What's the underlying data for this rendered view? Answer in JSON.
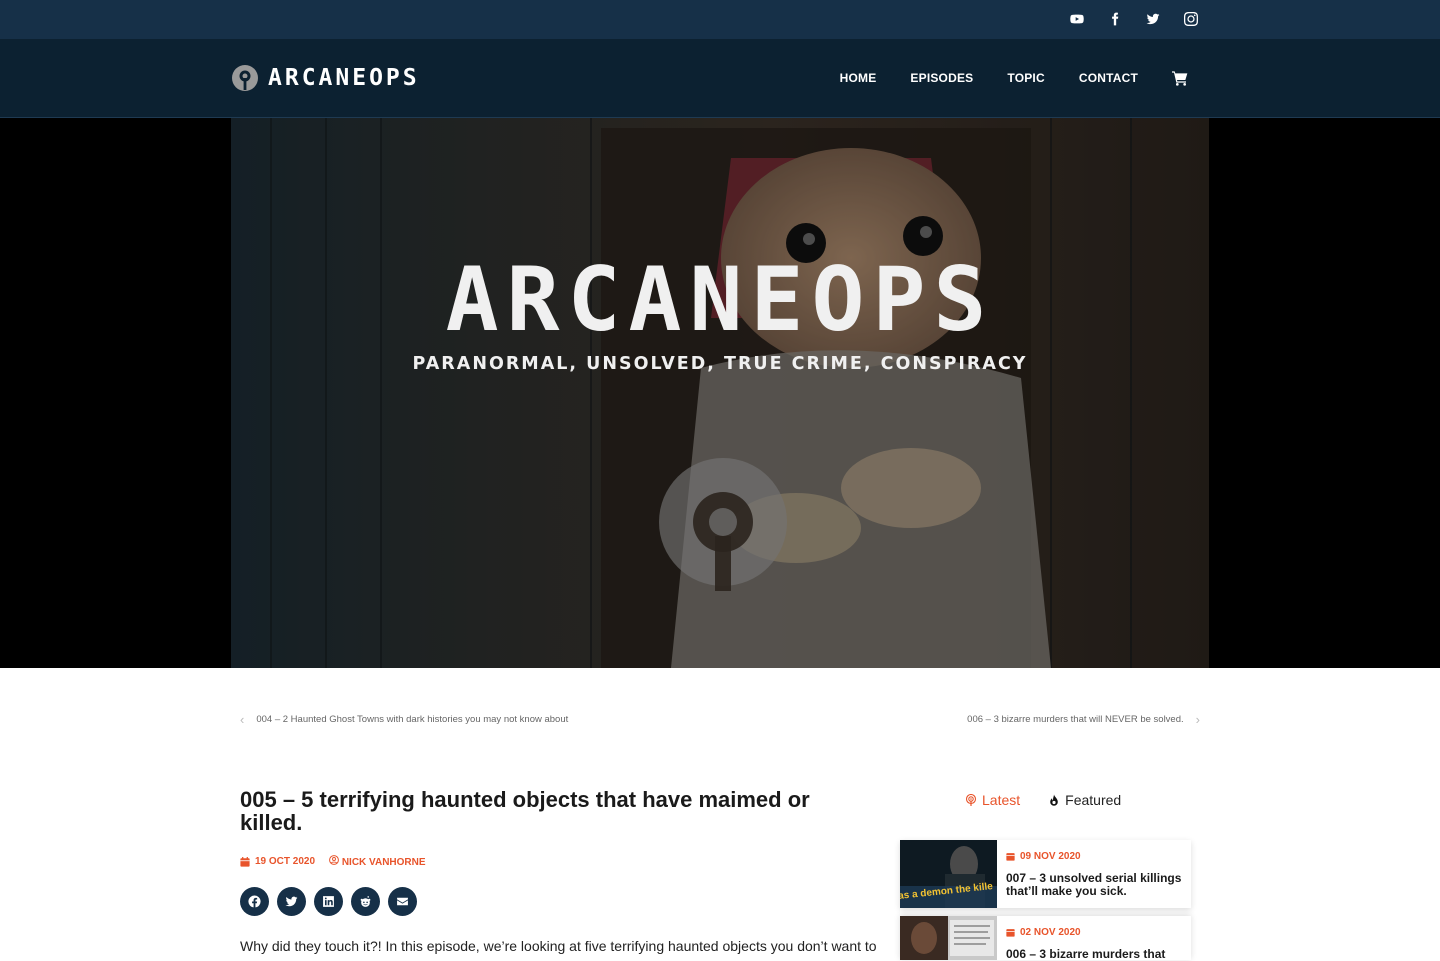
{
  "social": {
    "icons": [
      "youtube-icon",
      "facebook-icon",
      "twitter-icon",
      "instagram-icon"
    ]
  },
  "header": {
    "logo_text": "ARCANEOPS",
    "nav": [
      "HOME",
      "EPISODES",
      "TOPIC",
      "CONTACT"
    ],
    "cart_icon": "cart-icon"
  },
  "hero": {
    "title": "ARCANEOPS",
    "tagline": "PARANORMAL, UNSOLVED, TRUE CRIME, CONSPIRACY"
  },
  "post_nav": {
    "prev": "004 – 2 Haunted Ghost Towns with dark histories you may not know about",
    "next": "006 – 3 bizarre murders that will NEVER be solved."
  },
  "article": {
    "title": "005 – 5 terrifying haunted objects that have maimed or killed.",
    "date": "19 OCT 2020",
    "author": "NICK VANHORNE",
    "share_icons": [
      "facebook-icon",
      "twitter-icon",
      "linkedin-icon",
      "reddit-icon",
      "email-icon"
    ],
    "intro": "Why did they touch it?! In this episode, we’re looking at five terrifying haunted objects you don’t want to"
  },
  "sidebar": {
    "tabs": [
      {
        "label": "Latest",
        "active": true
      },
      {
        "label": "Featured",
        "active": false
      }
    ],
    "posts": [
      {
        "date": "09 NOV 2020",
        "title": "007 – 3 unsolved serial killings that’ll make you sick.",
        "thumb_text": "as a demon the kille"
      },
      {
        "date": "02 NOV 2020",
        "title": "006 – 3 bizarre murders that",
        "thumb_text": ""
      }
    ]
  },
  "colors": {
    "accent": "#e8542b",
    "navy": "#163048",
    "header_bg": "#0c2131"
  }
}
